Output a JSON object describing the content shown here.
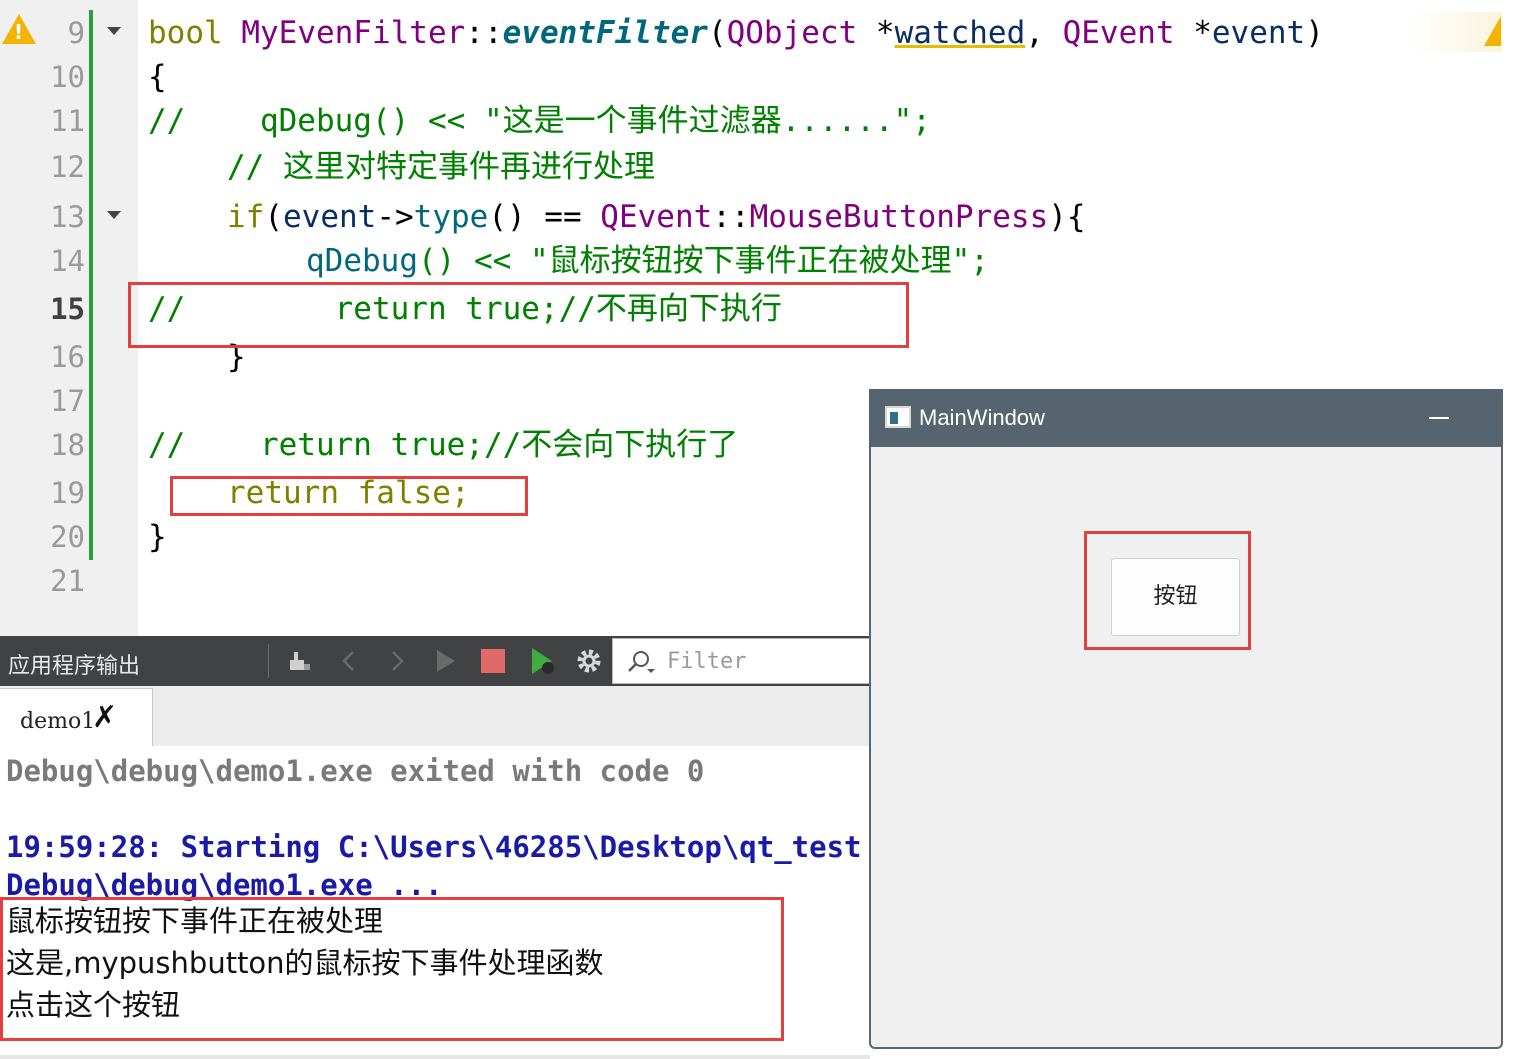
{
  "editor": {
    "lines": [
      {
        "num": "9"
      },
      {
        "num": "10",
        "text": "{"
      },
      {
        "num": "11",
        "comment": "//",
        "call": "qDebug",
        "rest": "() << \"这是一个事件过滤器......\";"
      },
      {
        "num": "12",
        "text": "// 这里对特定事件再进行处理"
      },
      {
        "num": "13"
      },
      {
        "num": "14",
        "call": "qDebug",
        "rest": "() << \"鼠标按钮按下事件正在被处理\";"
      },
      {
        "num": "15",
        "text": "//        return true;//不再向下执行"
      },
      {
        "num": "16",
        "text": "}"
      },
      {
        "num": "17",
        "text": ""
      },
      {
        "num": "18",
        "text": "//    return true;//不会向下执行了"
      },
      {
        "num": "19",
        "text": "return false;"
      },
      {
        "num": "20",
        "text": "}"
      },
      {
        "num": "21",
        "text": ""
      }
    ],
    "line9": {
      "type": "bool",
      "cls": "MyEvenFilter",
      "sep": "::",
      "fn": "eventFilter",
      "open": "(",
      "ptype1": "QObject",
      "star1": " *",
      "p1": "watched",
      "comma": ", ",
      "ptype2": "QEvent",
      "star2": " *",
      "p2": "event",
      "close": ")"
    },
    "line13": {
      "kw": "if",
      "open": "(",
      "obj": "event",
      "arrow": "->",
      "call": "type",
      "mid": "() == ",
      "cls": "QEvent",
      "sep": "::",
      "enm": "MouseButtonPress",
      "close": "){"
    }
  },
  "output_panel": {
    "title": "应用程序输出",
    "filter_placeholder": "Filter",
    "tab_label": "demo1",
    "lines": [
      "Debug\\debug\\demo1.exe exited with code 0",
      "19:59:28: Starting C:\\Users\\46285\\Desktop\\qt_test",
      "Debug\\debug\\demo1.exe ...",
      "鼠标按钮按下事件正在被处理",
      "这是,mypushbutton的鼠标按下事件处理函数",
      "点击这个按钮"
    ]
  },
  "main_window": {
    "title": "MainWindow",
    "button_label": "按钮"
  },
  "colors": {
    "highlight_box": "#e24040",
    "warning": "#f2b400",
    "change_bar": "#2aa03a"
  }
}
